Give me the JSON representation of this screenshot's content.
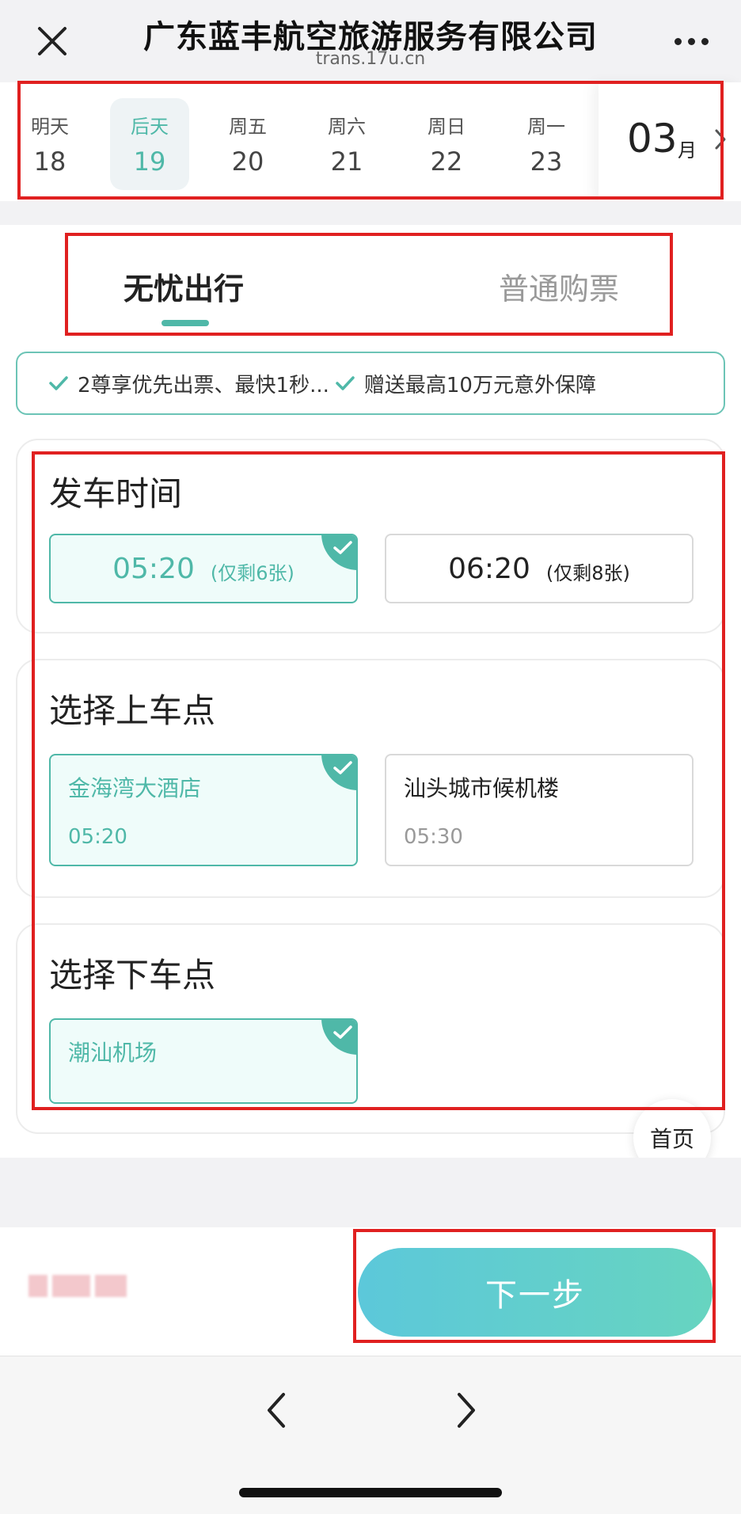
{
  "header": {
    "title": "广东蓝丰航空旅游服务有限公司",
    "subtitle": "trans.17u.cn"
  },
  "dates": [
    {
      "weekday": "明天",
      "day": "18",
      "selected": false
    },
    {
      "weekday": "后天",
      "day": "19",
      "selected": true
    },
    {
      "weekday": "周五",
      "day": "20",
      "selected": false
    },
    {
      "weekday": "周六",
      "day": "21",
      "selected": false
    },
    {
      "weekday": "周日",
      "day": "22",
      "selected": false
    },
    {
      "weekday": "周一",
      "day": "23",
      "selected": false
    }
  ],
  "month": {
    "number": "03",
    "unit": "月"
  },
  "tabs": {
    "active": "无忧出行",
    "inactive": "普通购票"
  },
  "benefits": [
    "2尊享优先出票、最快1秒...",
    "赠送最高10万元意外保障"
  ],
  "departure": {
    "title": "发车时间",
    "options": [
      {
        "time": "05:20",
        "remaining": "(仅剩6张)",
        "selected": true
      },
      {
        "time": "06:20",
        "remaining": "(仅剩8张)",
        "selected": false
      }
    ]
  },
  "boarding": {
    "title": "选择上车点",
    "options": [
      {
        "name": "金海湾大酒店",
        "time": "05:20",
        "selected": true
      },
      {
        "name": "汕头城市候机楼",
        "time": "05:30",
        "selected": false
      }
    ]
  },
  "dropoff": {
    "title": "选择下车点",
    "options": [
      {
        "name": "潮汕机场",
        "selected": true
      }
    ]
  },
  "home_label": "首页",
  "next_label": "下一步",
  "colors": {
    "accent": "#4fb8a8",
    "highlight": "#e02020"
  }
}
